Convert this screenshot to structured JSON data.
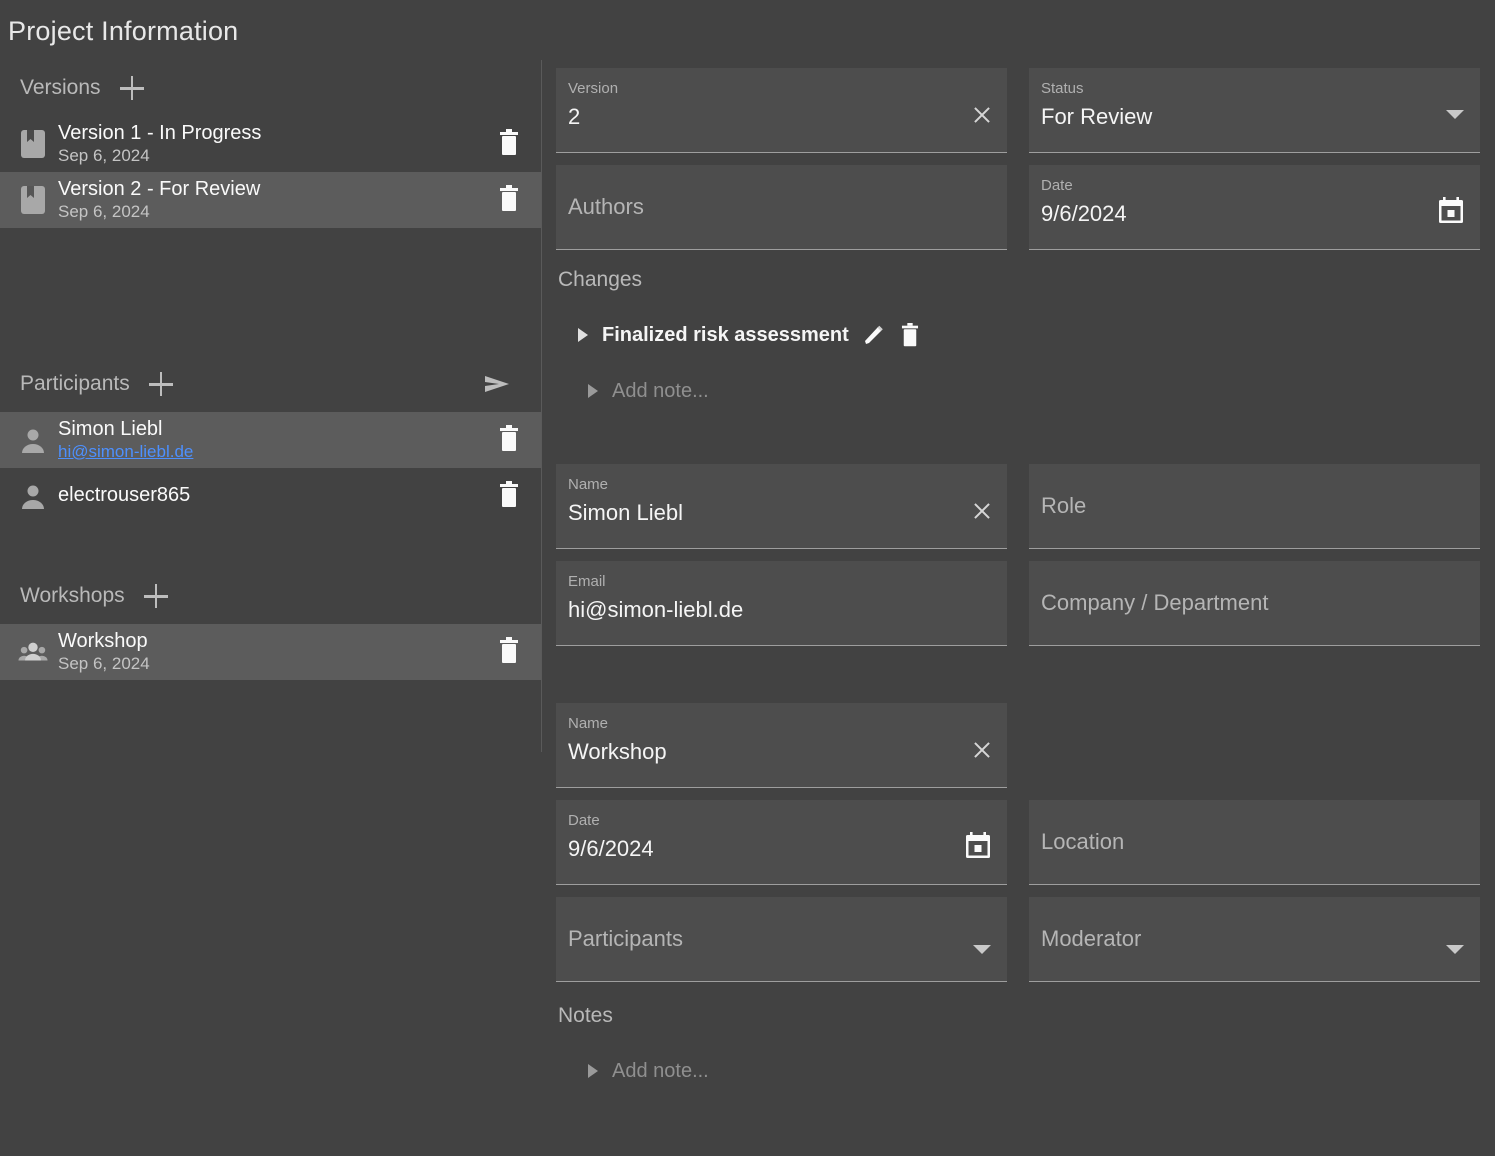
{
  "page": {
    "title": "Project Information"
  },
  "sidebar": {
    "versions": {
      "title": "Versions",
      "add_label": "+",
      "items": [
        {
          "name": "Version 1 - In Progress",
          "date": "Sep 6, 2024",
          "icon": "bookmark-icon",
          "selected": false
        },
        {
          "name": "Version 2 - For Review",
          "date": "Sep 6, 2024",
          "icon": "bookmark-icon",
          "selected": true
        }
      ]
    },
    "participants": {
      "title": "Participants",
      "add_label": "+",
      "send_icon": "send-icon",
      "items": [
        {
          "name": "Simon Liebl",
          "email": "hi@simon-liebl.de",
          "icon": "person-icon",
          "selected": true
        },
        {
          "name": "electrouser865",
          "email": "",
          "icon": "person-icon",
          "selected": false
        }
      ]
    },
    "workshops": {
      "title": "Workshops",
      "add_label": "+",
      "items": [
        {
          "name": "Workshop",
          "date": "Sep 6, 2024",
          "icon": "group-icon",
          "selected": true
        }
      ]
    }
  },
  "version_form": {
    "version": {
      "label": "Version",
      "value": "2"
    },
    "status": {
      "label": "Status",
      "value": "For Review"
    },
    "authors": {
      "label": "",
      "placeholder": "Authors",
      "value": ""
    },
    "date": {
      "label": "Date",
      "value": "9/6/2024"
    },
    "changes": {
      "title": "Changes",
      "items": [
        {
          "text": "Finalized risk assessment"
        }
      ],
      "add_placeholder": "Add note..."
    }
  },
  "participant_form": {
    "name": {
      "label": "Name",
      "value": "Simon Liebl"
    },
    "role": {
      "label": "",
      "placeholder": "Role",
      "value": ""
    },
    "email": {
      "label": "Email",
      "value": "hi@simon-liebl.de"
    },
    "company": {
      "label": "",
      "placeholder": "Company / Department",
      "value": ""
    }
  },
  "workshop_form": {
    "name": {
      "label": "Name",
      "value": "Workshop"
    },
    "date": {
      "label": "Date",
      "value": "9/6/2024"
    },
    "location": {
      "label": "",
      "placeholder": "Location",
      "value": ""
    },
    "participants": {
      "label": "",
      "placeholder": "Participants",
      "value": ""
    },
    "moderator": {
      "label": "",
      "placeholder": "Moderator",
      "value": ""
    },
    "notes": {
      "title": "Notes",
      "add_placeholder": "Add note..."
    }
  },
  "colors": {
    "background": "#424242",
    "field_background": "#4d4d4d",
    "selected_row": "#5c5c5c",
    "link": "#4d90fe",
    "text_primary": "#f5f5f5",
    "text_muted": "#b0b0b0"
  }
}
